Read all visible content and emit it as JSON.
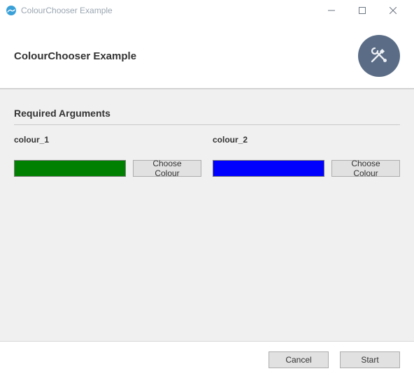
{
  "window": {
    "title": "ColourChooser Example"
  },
  "header": {
    "page_title": "ColourChooser Example",
    "icon_name": "wrench-screwdriver-icon"
  },
  "section": {
    "title": "Required Arguments"
  },
  "args": [
    {
      "label": "colour_1",
      "colour": "#008000",
      "button_label": "Choose Colour"
    },
    {
      "label": "colour_2",
      "colour": "#0000ff",
      "button_label": "Choose Colour"
    }
  ],
  "footer": {
    "cancel": "Cancel",
    "start": "Start"
  }
}
